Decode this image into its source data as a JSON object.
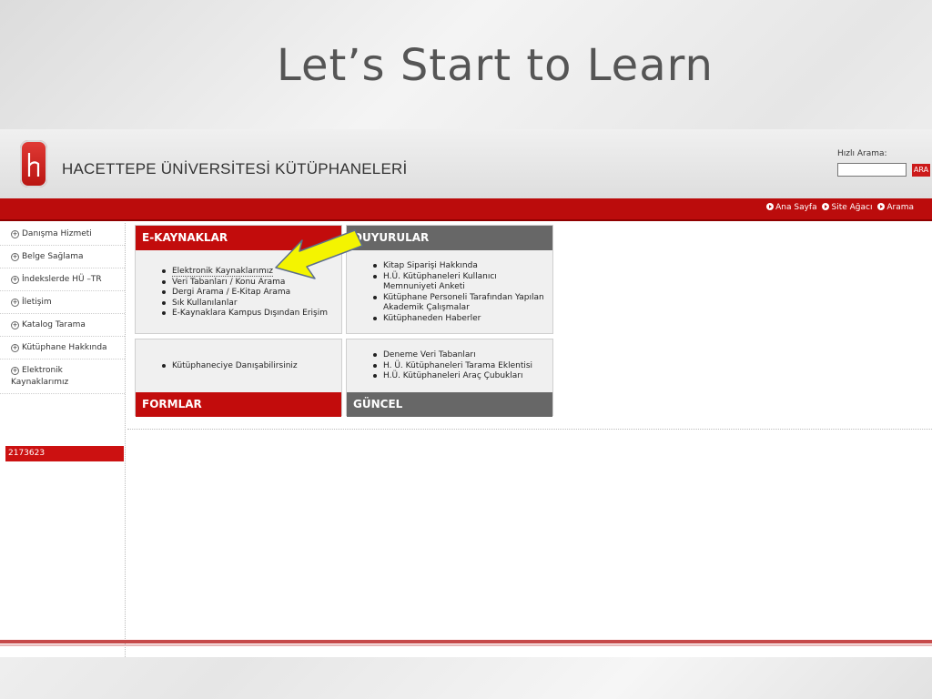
{
  "slide": {
    "title": "Let’s Start to Learn"
  },
  "header": {
    "org_name": "HACETTEPE ÜNİVERSİTESİ KÜTÜPHANELERİ",
    "search_label": "Hızlı Arama:",
    "search_value": "",
    "search_button": "ARA"
  },
  "topnav": {
    "items": [
      {
        "label": "Ana Sayfa"
      },
      {
        "label": "Site Ağacı"
      },
      {
        "label": "Arama"
      }
    ]
  },
  "sidebar": {
    "items": [
      {
        "label": "Danışma Hizmeti"
      },
      {
        "label": "Belge Sağlama"
      },
      {
        "label": "İndekslerde HÜ –TR"
      },
      {
        "label": "İletişim"
      },
      {
        "label": "Katalog Tarama"
      },
      {
        "label": "Kütüphane Hakkında"
      },
      {
        "label": "Elektronik Kaynaklarımız"
      }
    ],
    "counter": "2173623"
  },
  "panels": {
    "ekaynaklar": {
      "title": "E-KAYNAKLAR",
      "links": [
        "Elektronik Kaynaklarımız",
        "Veri Tabanları / Konu Arama",
        "Dergi Arama / E-Kitap Arama",
        "Sık Kullanılanlar",
        "E-Kaynaklara Kampus Dışından Erişim"
      ]
    },
    "duyurular": {
      "title": "DUYURULAR",
      "links": [
        "Kitap Siparişi Hakkında",
        "H.Ü. Kütüphaneleri Kullanıcı Memnuniyeti Anketi",
        "Kütüphane Personeli Tarafından Yapılan Akademik Çalışmalar",
        "Kütüphaneden Haberler"
      ]
    },
    "formlar": {
      "title": "FORMLAR",
      "links": [
        "Kütüphaneciye Danışabilirsiniz"
      ]
    },
    "guncel": {
      "title": "GÜNCEL",
      "links": [
        "Deneme Veri Tabanları",
        "H. Ü. Kütüphaneleri Tarama Eklentisi",
        "H.Ü. Kütüphaneleri Araç Çubukları"
      ]
    }
  },
  "colors": {
    "accent_red": "#bb0c0c",
    "panel_grey": "#676767",
    "arrow_yellow": "#f4f400"
  }
}
